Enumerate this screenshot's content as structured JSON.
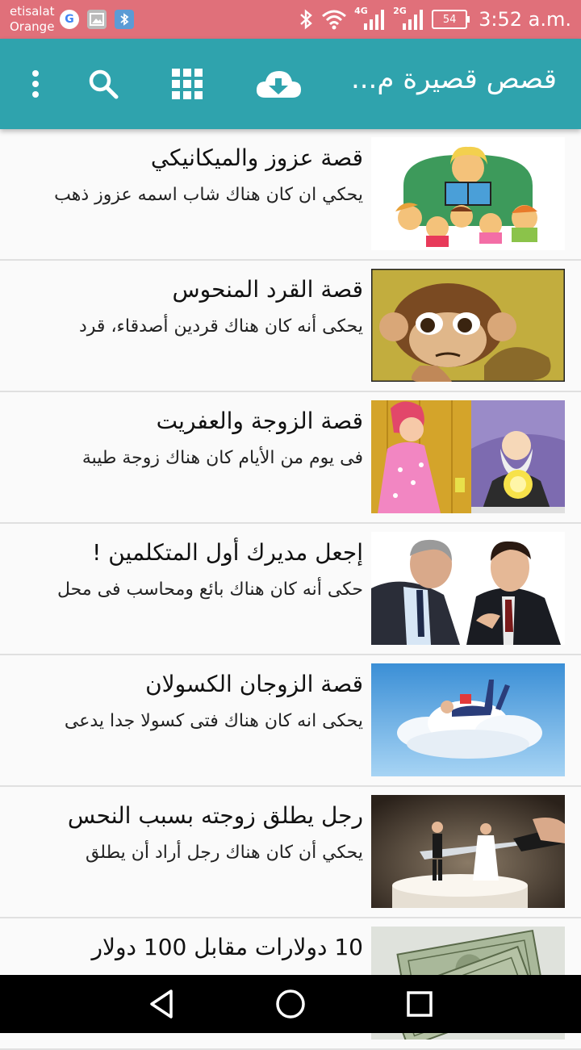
{
  "status_bar": {
    "carrier_line1": "etisalat",
    "carrier_line2": "Orange",
    "network_4g": "4G",
    "network_2g": "2G",
    "battery": "54",
    "time": "3:52 a.m."
  },
  "app_bar": {
    "title": "قصص قصيرة م...",
    "actions": [
      "download-icon",
      "grid-icon",
      "search-icon",
      "more-vert-icon"
    ],
    "color": "#2fa3ad"
  },
  "stories": [
    {
      "title": "قصة عزوز والميكانيكي",
      "subtitle": "يحكي ان كان هناك شاب اسمه عزوز ذهب",
      "image": "storyteller-illustration"
    },
    {
      "title": "قصة القرد المنحوس",
      "subtitle": "يحكى أنه كان هناك قردين أصدقاء، قرد",
      "image": "monkey-illustration"
    },
    {
      "title": "قصة الزوجة والعفريت",
      "subtitle": "فى يوم من الأيام كان هناك زوجة طيبة",
      "image": "wife-genie-illustration"
    },
    {
      "title": "إجعل مديرك أول المتكلمين !",
      "subtitle": "حكى أنه كان هناك بائع ومحاسب فى محل",
      "image": "businessmen-photo"
    },
    {
      "title": "قصة الزوجان الكسولان",
      "subtitle": "يحكى انه كان هناك فتى كسولا جدا يدعى",
      "image": "cloud-photo"
    },
    {
      "title": "رجل يطلق زوجته بسبب النحس",
      "subtitle": "يحكي أن كان هناك رجل أراد أن يطلق",
      "image": "wedding-cake-photo"
    },
    {
      "title": "10 دولارات مقابل 100 دولار",
      "subtitle": "",
      "image": "dollar-bills-photo"
    }
  ],
  "nav_bar": [
    "back-icon",
    "home-icon",
    "recents-icon"
  ]
}
